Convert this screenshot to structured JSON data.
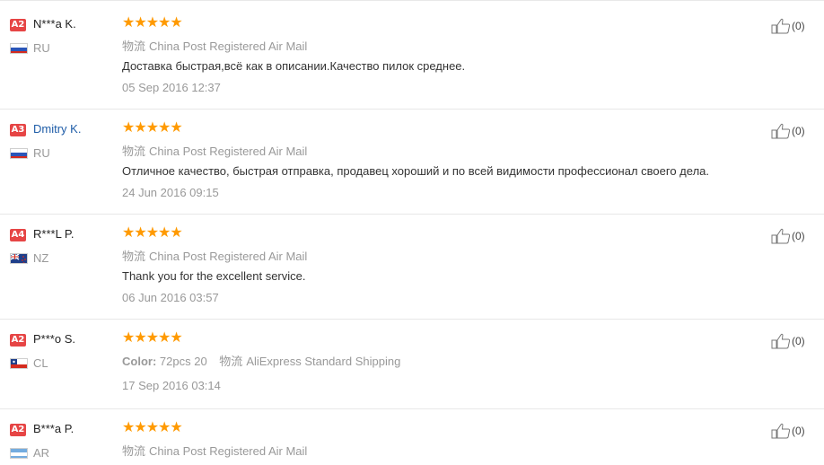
{
  "icons": {
    "shipping": "shipping-icon",
    "stars": "star-icon",
    "like": "thumbs-up-icon"
  },
  "colors": {
    "badge": "#e64545",
    "star": "#ff9a00",
    "link": "#1f5da8",
    "muted": "#999999"
  },
  "reviews": [
    {
      "badge": "A2",
      "name": "N***a K.",
      "country": "RU",
      "stars": "★★★★★",
      "ship_icon": "物流",
      "ship": "China Post Registered Air Mail",
      "text": "Доставка быстрая,всё как в описании.Качество пилок среднее.",
      "date": "05 Sep 2016 12:37",
      "likes": "(0)"
    },
    {
      "badge": "A3",
      "name": "Dmitry K.",
      "country": "RU",
      "stars": "★★★★★",
      "ship_icon": "物流",
      "ship": "China Post Registered Air Mail",
      "text": "Отличное качество, быстрая отправка, продавец хороший и по всей видимости профессионал своего дела.",
      "date": "24 Jun 2016 09:15",
      "likes": "(0)"
    },
    {
      "badge": "A4",
      "name": "R***L P.",
      "country": "NZ",
      "stars": "★★★★★",
      "ship_icon": "物流",
      "ship": "China Post Registered Air Mail",
      "text": "Thank you for the excellent service.",
      "date": "06 Jun 2016 03:57",
      "likes": "(0)"
    },
    {
      "badge": "A2",
      "name": "P***o S.",
      "country": "CL",
      "stars": "★★★★★",
      "color_label": "Color:",
      "color_value": "72pcs 20",
      "ship_icon": "物流",
      "ship": "AliExpress Standard Shipping",
      "date": "17 Sep 2016 03:14",
      "likes": "(0)"
    },
    {
      "badge": "A2",
      "name": "B***a P.",
      "country": "AR",
      "stars": "★★★★★",
      "ship_icon": "物流",
      "ship": "China Post Registered Air Mail",
      "likes": "(0)"
    }
  ]
}
